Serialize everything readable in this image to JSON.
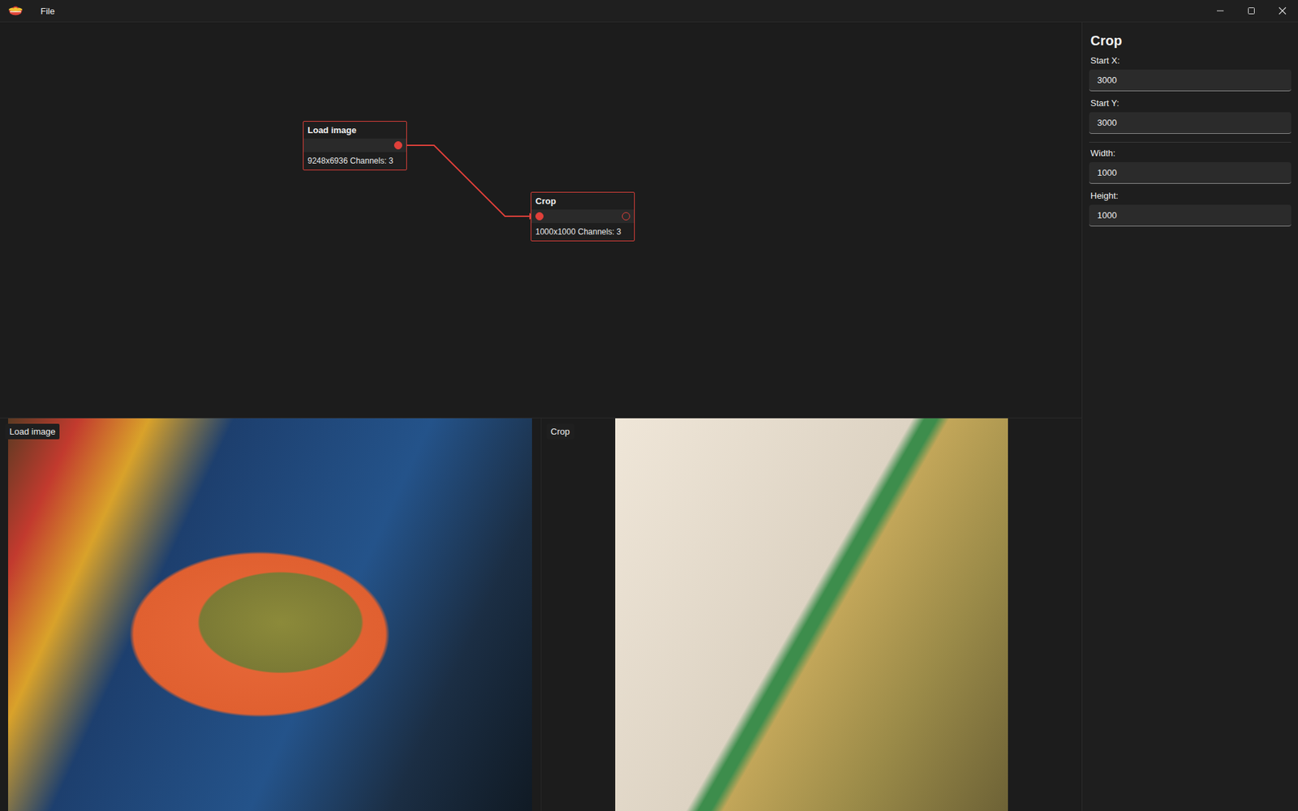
{
  "window": {
    "menu": [
      "File"
    ]
  },
  "graph": {
    "nodes": [
      {
        "title": "Load image",
        "info": "9248x6936 Channels: 3",
        "inputs": [],
        "outputs": [
          {
            "connected": true
          }
        ]
      },
      {
        "title": "Crop",
        "info": "1000x1000 Channels: 3",
        "inputs": [
          {
            "connected": true
          }
        ],
        "outputs": [
          {
            "connected": false
          }
        ]
      }
    ],
    "edges": [
      {
        "from": 0,
        "to": 1
      }
    ]
  },
  "properties": {
    "title": "Crop",
    "groups": [
      [
        {
          "label": "Start X:",
          "value": "3000"
        },
        {
          "label": "Start Y:",
          "value": "3000"
        }
      ],
      [
        {
          "label": "Width:",
          "value": "1000"
        },
        {
          "label": "Height:",
          "value": "1000"
        }
      ]
    ]
  },
  "previews": [
    {
      "label": "Load image"
    },
    {
      "label": "Crop"
    }
  ]
}
